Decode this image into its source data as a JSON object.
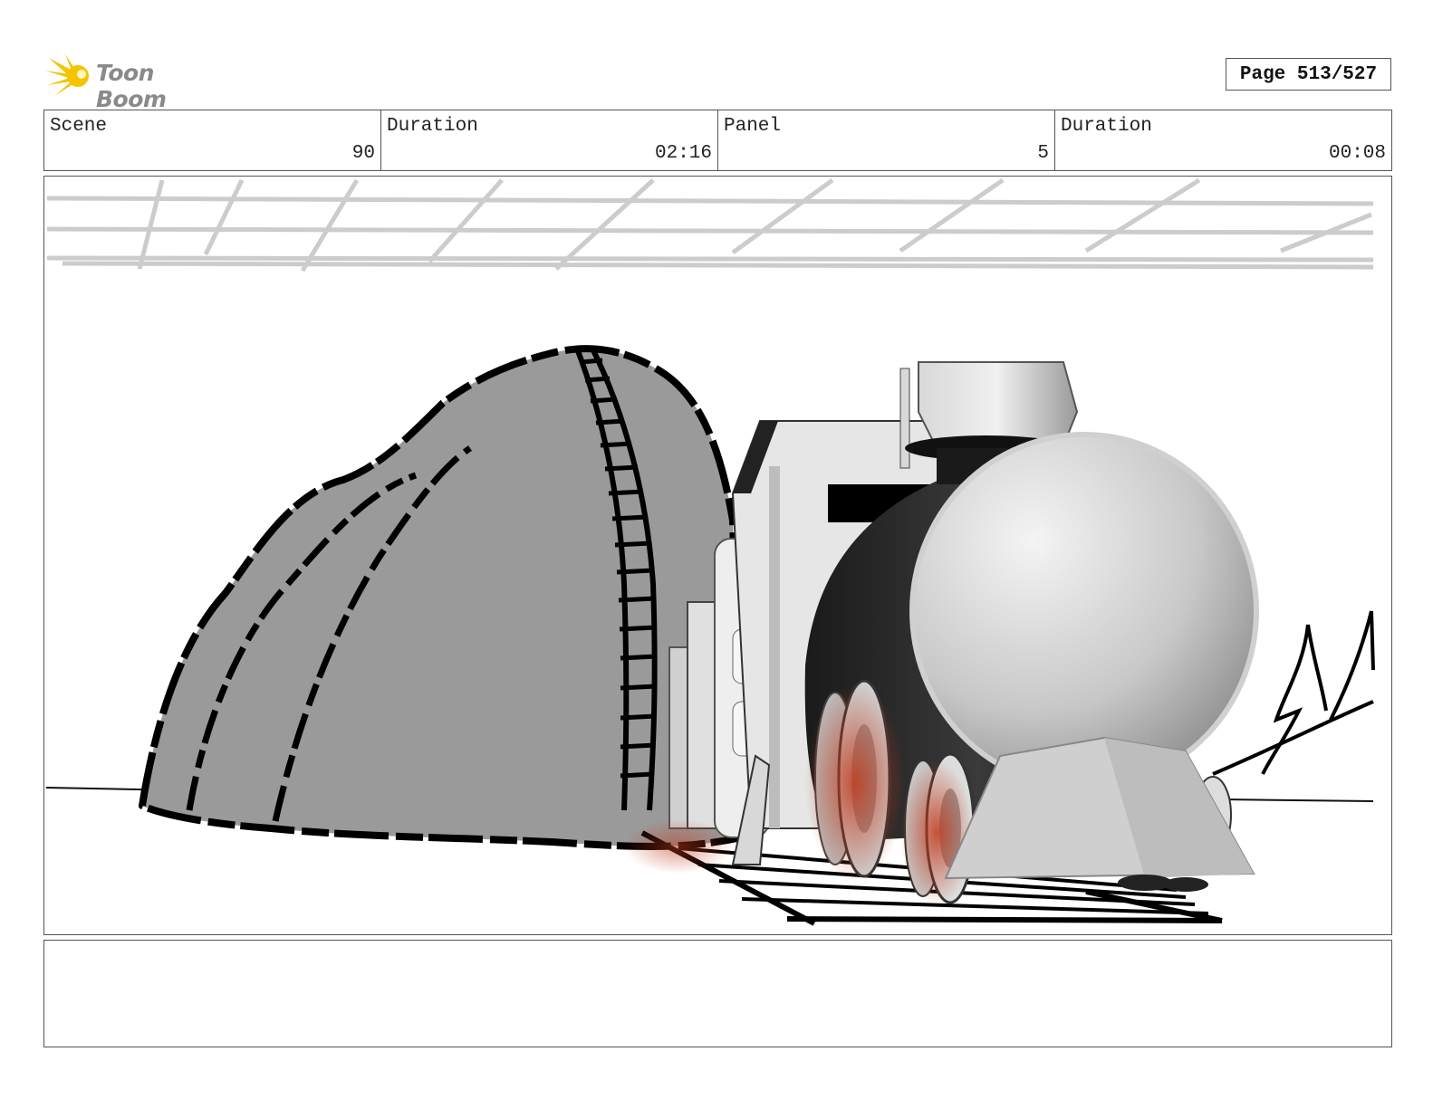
{
  "header": {
    "logo_text": "Toon Boom",
    "page_label": "Page 513/527"
  },
  "info": {
    "scene_label": "Scene",
    "scene_value": "90",
    "scene_duration_label": "Duration",
    "scene_duration_value": "02:16",
    "panel_label": "Panel",
    "panel_value": "5",
    "panel_duration_label": "Duration",
    "panel_duration_value": "00:08"
  },
  "notes": {
    "text": ""
  },
  "colors": {
    "logo_accent": "#f5c400",
    "logo_text": "#8a8a8a",
    "border": "#555555",
    "rock": "#9a9a9a",
    "wheel_glow": "#c0391b"
  }
}
